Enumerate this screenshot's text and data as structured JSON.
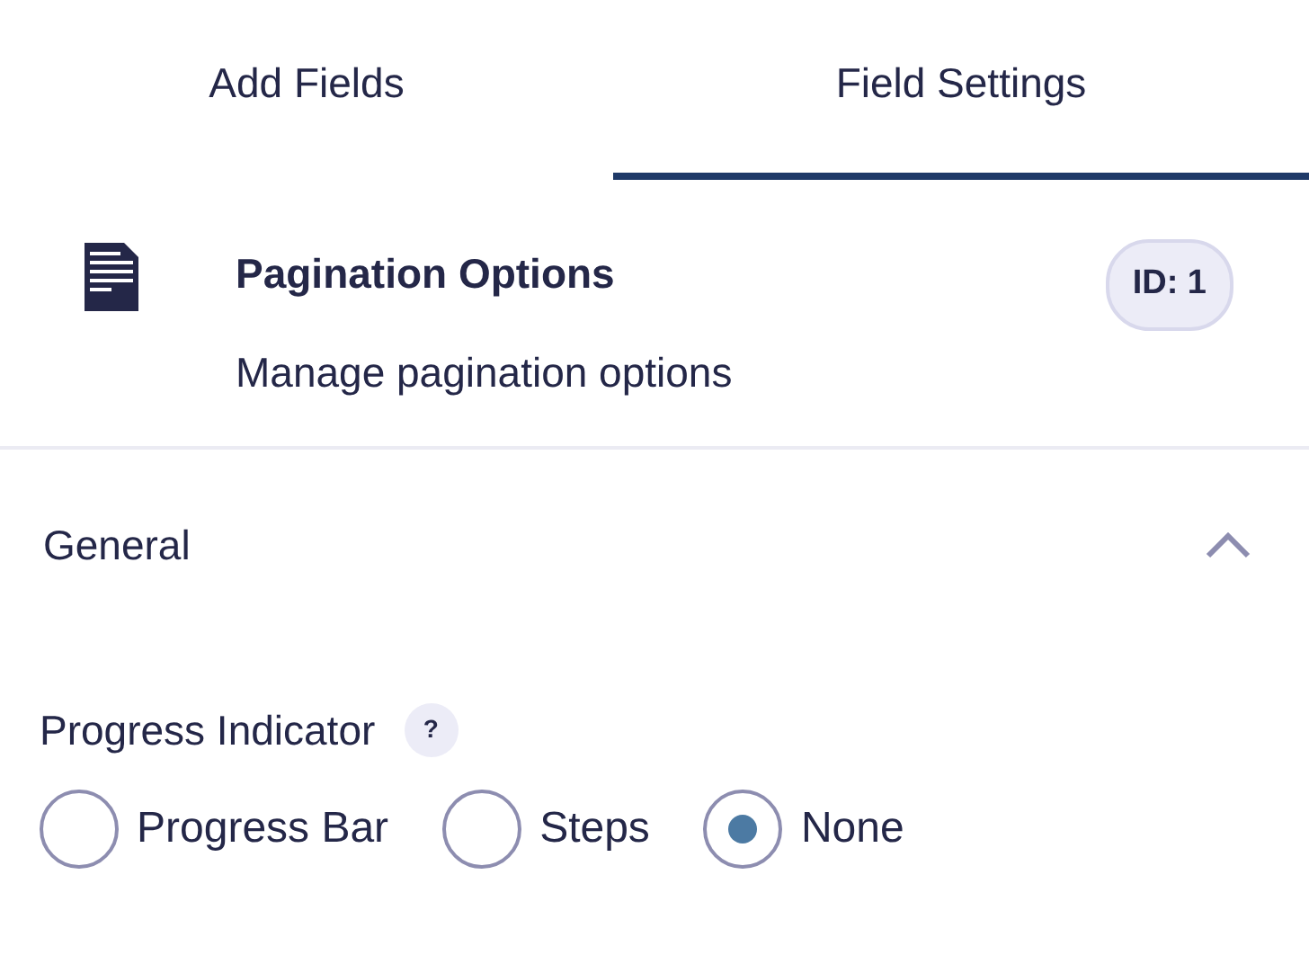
{
  "tabs": [
    {
      "label": "Add Fields",
      "selected": false
    },
    {
      "label": "Field Settings",
      "selected": true
    }
  ],
  "field": {
    "title": "Pagination Options",
    "description": "Manage pagination options",
    "id_badge": "ID: 1"
  },
  "section": {
    "title": "General",
    "expanded": true
  },
  "setting": {
    "label": "Progress Indicator",
    "help": "?",
    "options": [
      {
        "label": "Progress Bar",
        "selected": false
      },
      {
        "label": "Steps",
        "selected": false
      },
      {
        "label": "None",
        "selected": true
      }
    ]
  }
}
